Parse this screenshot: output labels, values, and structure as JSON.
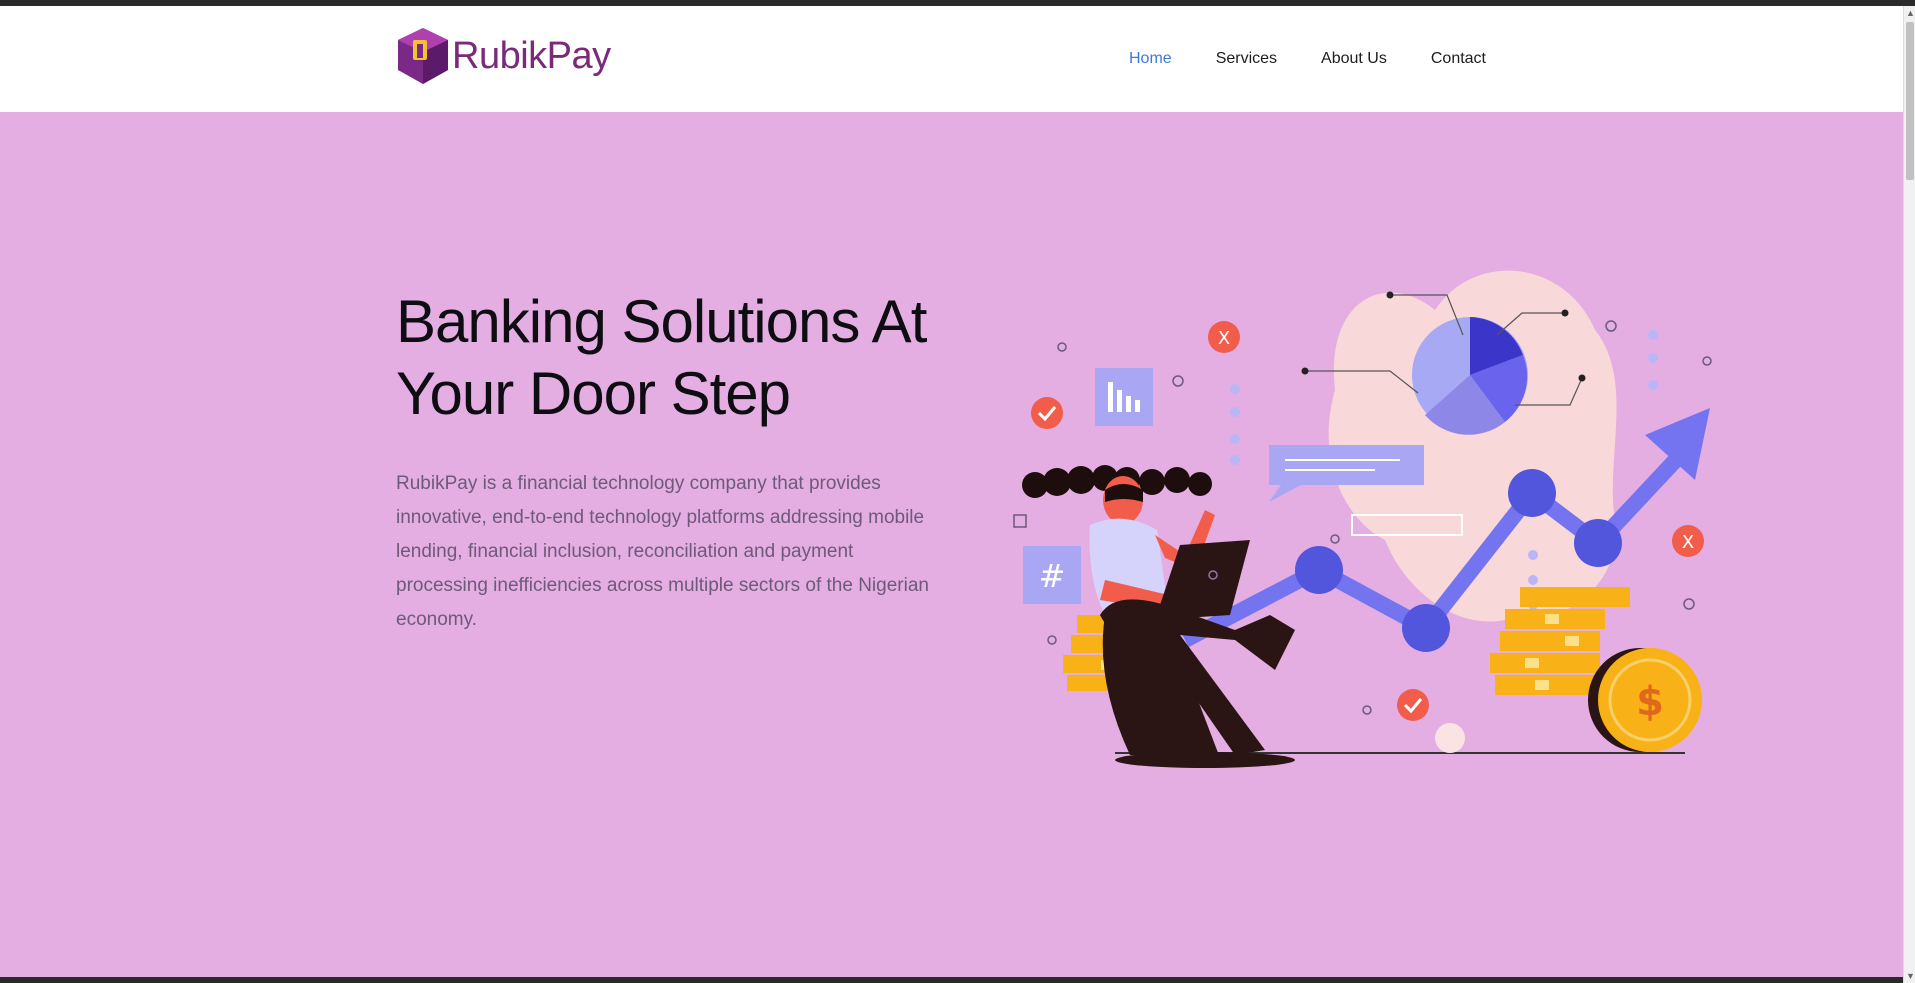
{
  "brand": {
    "name": "RubikPay"
  },
  "nav": {
    "items": [
      {
        "label": "Home",
        "active": true
      },
      {
        "label": "Services",
        "active": false
      },
      {
        "label": "About Us",
        "active": false
      },
      {
        "label": "Contact",
        "active": false
      }
    ]
  },
  "hero": {
    "headline": "Banking Solutions At Your Door Step",
    "description": "RubikPay is a financial technology company that provides innovative, end-to-end technology platforms addressing mobile lending, financial inclusion, reconciliation and payment processing inefficiencies across multiple sectors of the Nigerian economy."
  },
  "colors": {
    "hero_bg": "#e4aee3",
    "nav_active": "#3c7ad9",
    "brand": "#7a2a7a"
  },
  "icons": [
    "logo-cube-icon",
    "pie-chart-icon",
    "trend-arrow-icon",
    "check-icon",
    "x-icon",
    "hash-icon",
    "bar-chart-icon",
    "dollar-coin-icon"
  ]
}
